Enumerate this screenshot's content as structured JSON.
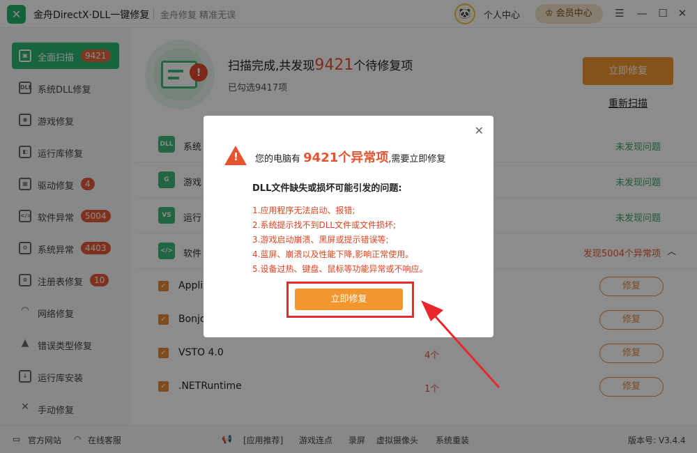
{
  "titlebar": {
    "app_title": "金舟DirectX·DLL一键修复",
    "slogan": "金舟修复 精准无误",
    "personal_center": "个人中心",
    "vip_center": "会员中心"
  },
  "sidebar": {
    "items": [
      {
        "label": "全面扫描",
        "badge": "9421",
        "icon": "scan-icon"
      },
      {
        "label": "系统DLL修复",
        "badge": "",
        "icon": "dll-icon"
      },
      {
        "label": "游戏修复",
        "badge": "",
        "icon": "gamepad-icon"
      },
      {
        "label": "运行库修复",
        "badge": "",
        "icon": "runtime-icon"
      },
      {
        "label": "驱动修复",
        "badge": "4",
        "icon": "driver-icon"
      },
      {
        "label": "软件异常",
        "badge": "5004",
        "icon": "code-icon"
      },
      {
        "label": "系统异常",
        "badge": "4403",
        "icon": "gear-icon"
      },
      {
        "label": "注册表修复",
        "badge": "10",
        "icon": "registry-icon"
      },
      {
        "label": "网络修复",
        "badge": "",
        "icon": "wifi-icon"
      },
      {
        "label": "错误类型修复",
        "badge": "",
        "icon": "warning-icon"
      },
      {
        "label": "运行库安装",
        "badge": "",
        "icon": "install-icon"
      },
      {
        "label": "手动修复",
        "badge": "",
        "icon": "wrench-icon"
      }
    ]
  },
  "header": {
    "title_prefix": "扫描完成,共发现",
    "title_count": "9421",
    "title_suffix": "个待修复项",
    "subtitle": "已勾选9417项",
    "fix_now": "立即修复",
    "rescan": "重新扫描"
  },
  "categories": [
    {
      "name": "系统",
      "status": "未发现问题",
      "icon_text": "DLL"
    },
    {
      "name": "游戏",
      "status": "未发现问题",
      "icon_text": "G"
    },
    {
      "name": "运行",
      "status": "未发现问题",
      "icon_text": "VS"
    },
    {
      "name": "软件",
      "status": "发现5004个异常项",
      "icon_text": "</>"
    }
  ],
  "items": [
    {
      "name": "Appli",
      "count": "",
      "button": "修复"
    },
    {
      "name": "Bonjo",
      "count": "",
      "button": "修复"
    },
    {
      "name": "VSTO 4.0",
      "count": "4个",
      "button": "修复"
    },
    {
      "name": ".NETRuntime",
      "count": "1个",
      "button": "修复"
    }
  ],
  "modal": {
    "headline_prefix": "您的电脑有",
    "headline_count": "9421个异常项",
    "headline_suffix": ",需要立即修复",
    "section_title": "DLL文件缺失或损坏可能引发的问题:",
    "problems": [
      "1.应用程序无法启动、报错;",
      "2.系统提示找不到DLL文件或文件损坏;",
      "3.游戏启动崩溃、黑屏或提示错误等;",
      "4.蓝屏、崩溃以及性能下降,影响正常使用。",
      "5.设备过热、键盘、鼠标等功能异常或不响应。"
    ],
    "button": "立即修复"
  },
  "footer": {
    "website": "官方网站",
    "support": "在线客服",
    "recommend": "[应用推荐]",
    "links": [
      "游戏连点",
      "录屏",
      "虚拟摄像头",
      "系统重装"
    ],
    "version": "版本号: V3.4.4"
  },
  "colors": {
    "brand_green": "#2bb673",
    "accent_orange": "#f3962e",
    "alert_red": "#e8532f"
  }
}
